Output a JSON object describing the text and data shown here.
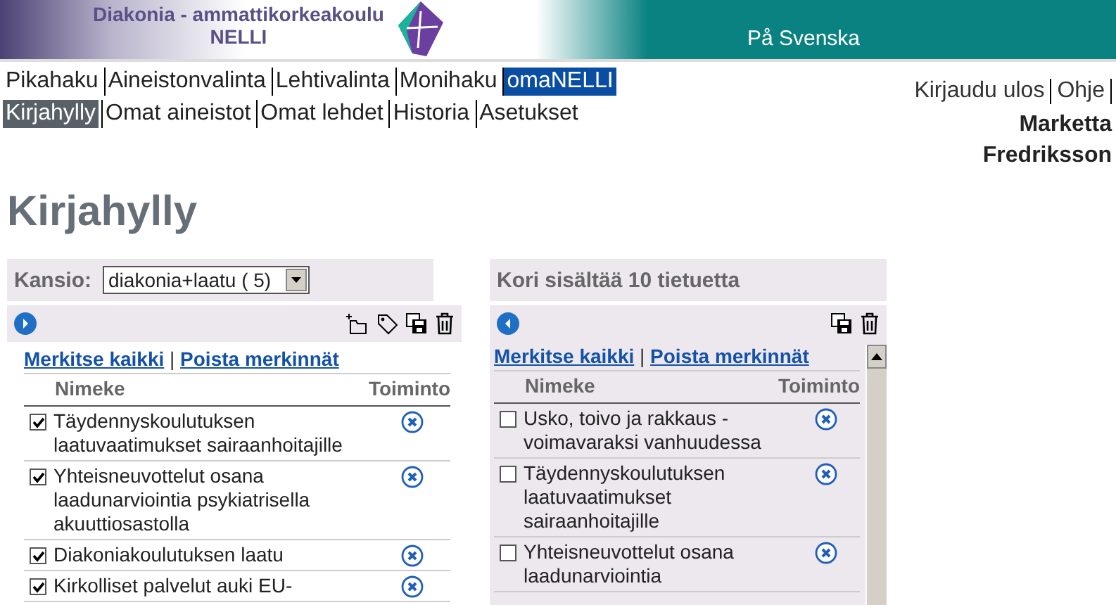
{
  "header": {
    "school": "Diakonia - ammattikorkeakoulu",
    "service": "NELLI",
    "language_link": "På Svenska"
  },
  "nav_primary": [
    {
      "label": "Pikahaku",
      "selected": false
    },
    {
      "label": "Aineistonvalinta",
      "selected": false
    },
    {
      "label": "Lehtivalinta",
      "selected": false
    },
    {
      "label": "Monihaku",
      "selected": false
    },
    {
      "label": "omaNELLI",
      "selected": true
    }
  ],
  "nav_secondary": [
    {
      "label": "Kirjahylly",
      "selected": true
    },
    {
      "label": "Omat aineistot",
      "selected": false
    },
    {
      "label": "Omat lehdet",
      "selected": false
    },
    {
      "label": "Historia",
      "selected": false
    },
    {
      "label": "Asetukset",
      "selected": false
    }
  ],
  "user_links": [
    "Kirjaudu ulos",
    "Ohje"
  ],
  "user_name": "Marketta Fredriksson",
  "page_title": "Kirjahylly",
  "folder_panel": {
    "label": "Kansio:",
    "folder": "diakonia+laatu ( 5)",
    "mark_all": "Merkitse kaikki",
    "separator": "|",
    "unmark": "Poista merkinnät",
    "columns": [
      "Nimeke",
      "Toiminto"
    ],
    "rows": [
      {
        "title": "Täydennyskoulutuksen laatuvaatimukset sairaanhoitajille",
        "checked": true
      },
      {
        "title": "Yhteisneuvottelut osana laadunarviointia psykiatrisella akuuttiosastolla",
        "checked": true
      },
      {
        "title": "Diakoniakoulutuksen laatu",
        "checked": true
      },
      {
        "title": "Kirkolliset palvelut auki EU-",
        "checked": true
      }
    ]
  },
  "basket_panel": {
    "heading": "Kori sisältää 10 tietuetta",
    "mark_all": "Merkitse kaikki",
    "separator": "|",
    "unmark": "Poista merkinnät",
    "columns": [
      "Nimeke",
      "Toiminto"
    ],
    "rows": [
      {
        "title": "Usko, toivo ja rakkaus - voimavaraksi vanhuudessa",
        "checked": false
      },
      {
        "title": "Täydennyskoulutuksen laatuvaatimukset sairaanhoitajille",
        "checked": false
      },
      {
        "title": "Yhteisneuvottelut osana laadunarviointia",
        "checked": false
      }
    ]
  }
}
